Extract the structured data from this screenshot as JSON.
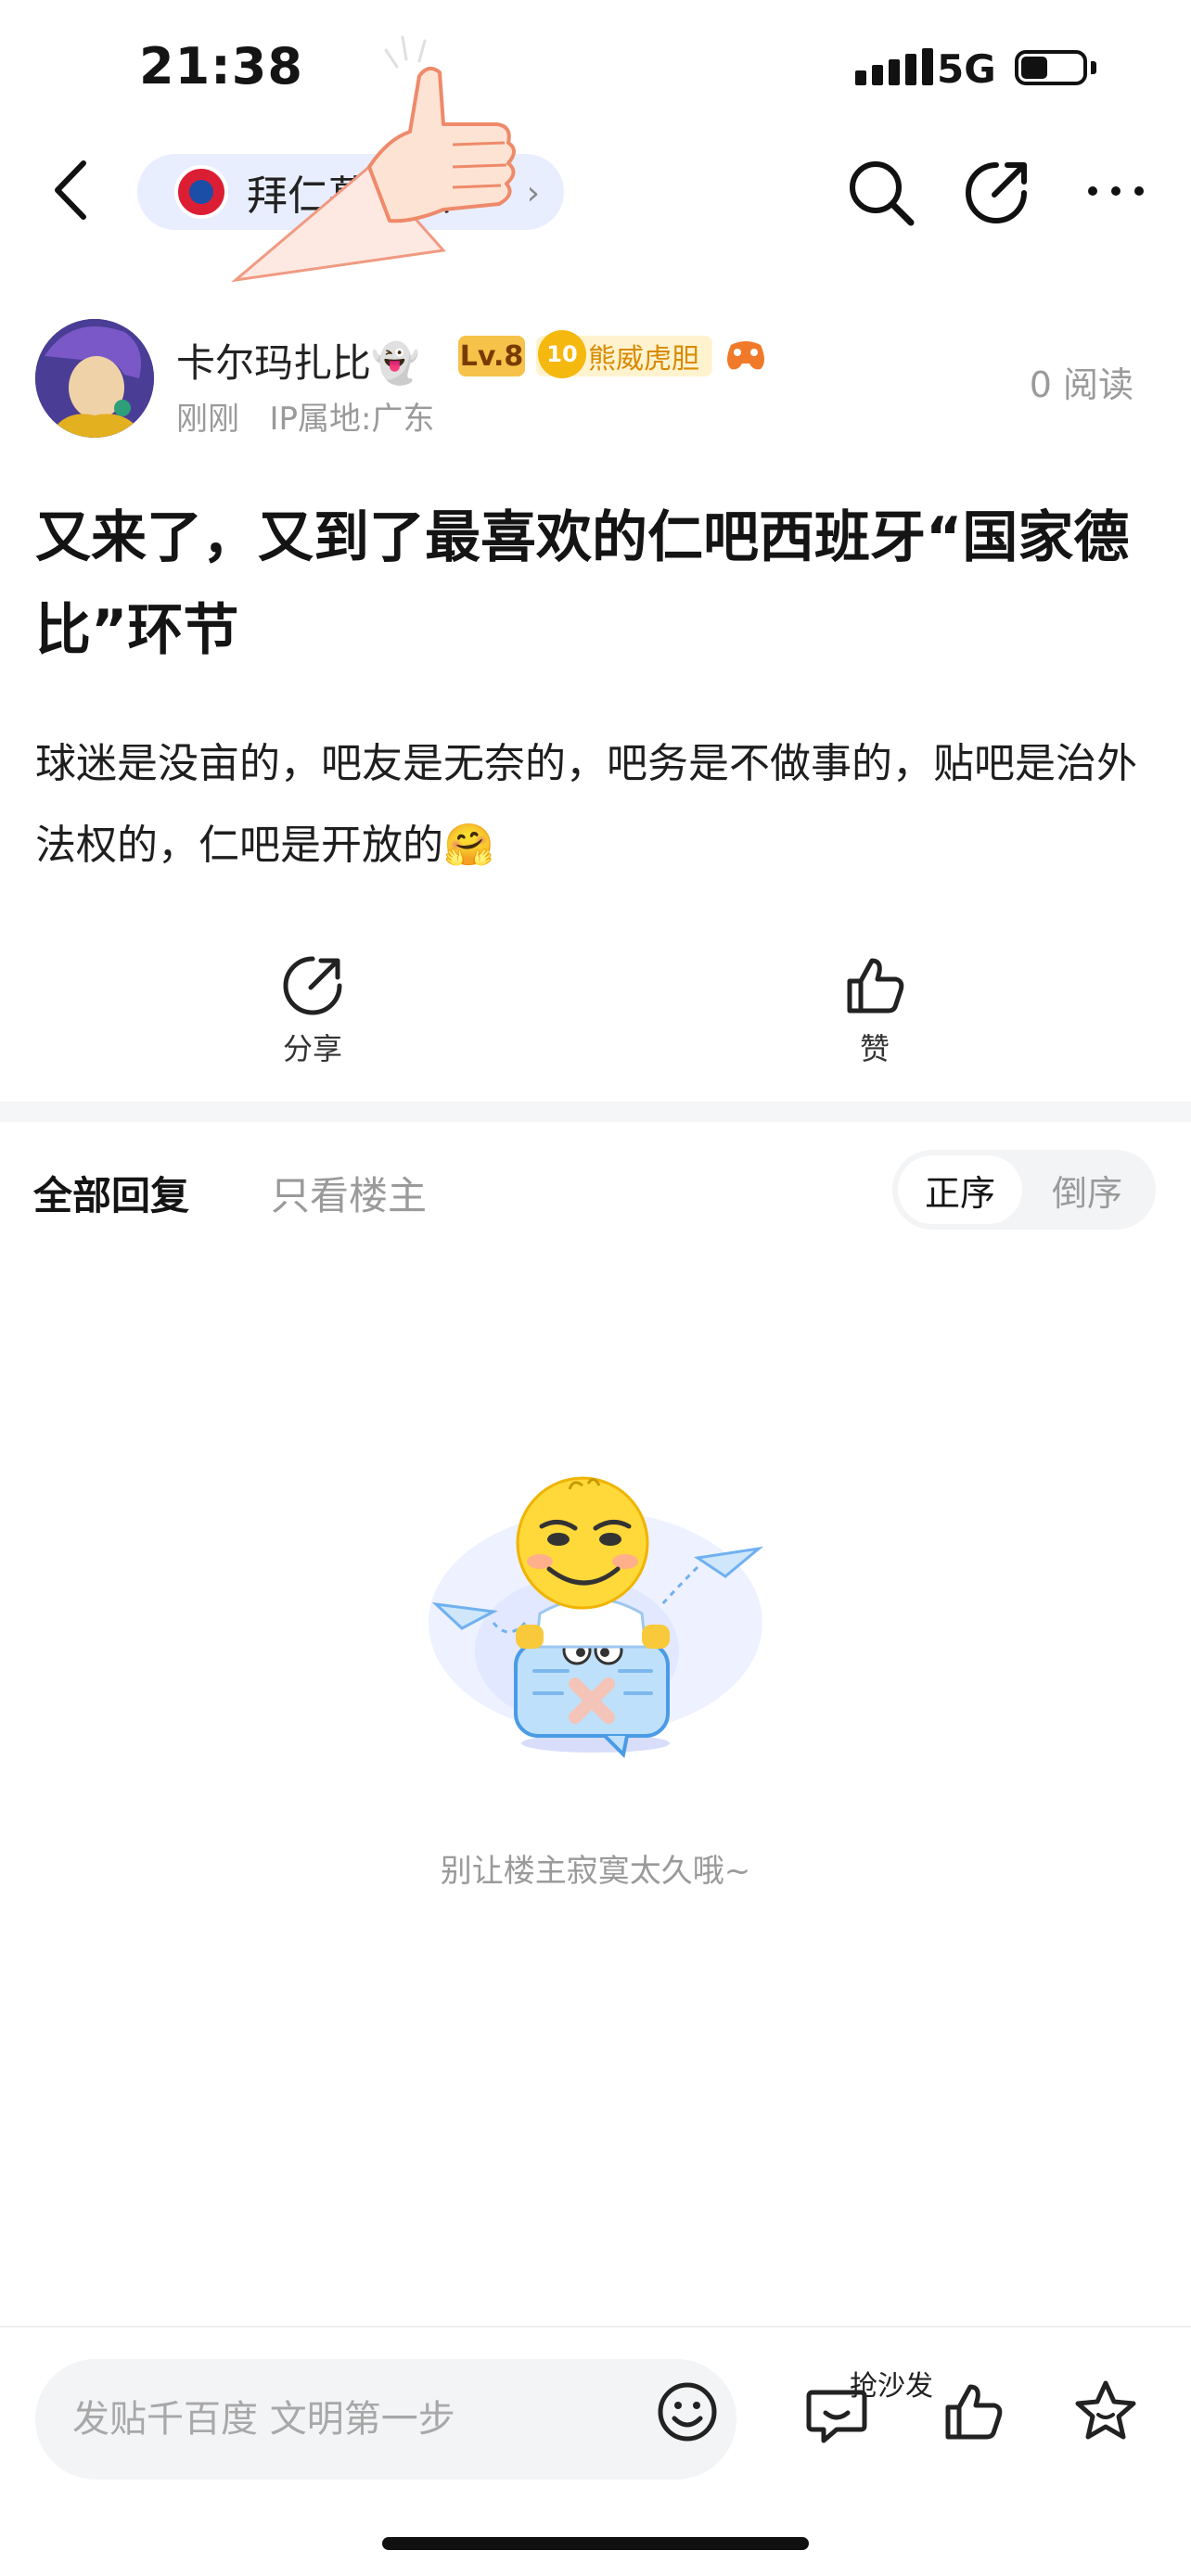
{
  "status_bar": {
    "time": "21:38",
    "network": "5G"
  },
  "nav": {
    "forum_name": "拜仁慕尼黑",
    "icons": [
      "back-chevron-icon",
      "search-icon",
      "edit-icon",
      "more-icon"
    ]
  },
  "post": {
    "author": "卡尔玛扎比",
    "author_emoji": "👻",
    "level": "Lv.8",
    "tag_level": "10",
    "tag": "熊威虎胆",
    "time": "刚刚",
    "ip": "IP属地:广东",
    "reads": "0 阅读",
    "title": "又来了，又到了最喜欢的仁吧西班牙“国家德比”环节",
    "body": "球迷是没亩的，吧友是无奈的，吧务是不做事的，贴吧是治外法权的，仁吧是开放的🤗"
  },
  "actions": {
    "share_label": "分享",
    "like_label": "赞"
  },
  "replies": {
    "tab_all": "全部回复",
    "tab_owner": "只看楼主",
    "sort_asc": "正序",
    "sort_desc": "倒序",
    "empty_text": "别让楼主寂寞太久哦~"
  },
  "bottom_bar": {
    "input_placeholder": "发贴千百度 文明第一步",
    "sofa_label": "抢沙发"
  },
  "colors": {
    "accent_bg": "#e9eeff",
    "muted_text": "#9a9a9a",
    "level_badge": "#f6c24a",
    "tag_badge": "#fff3cf"
  }
}
